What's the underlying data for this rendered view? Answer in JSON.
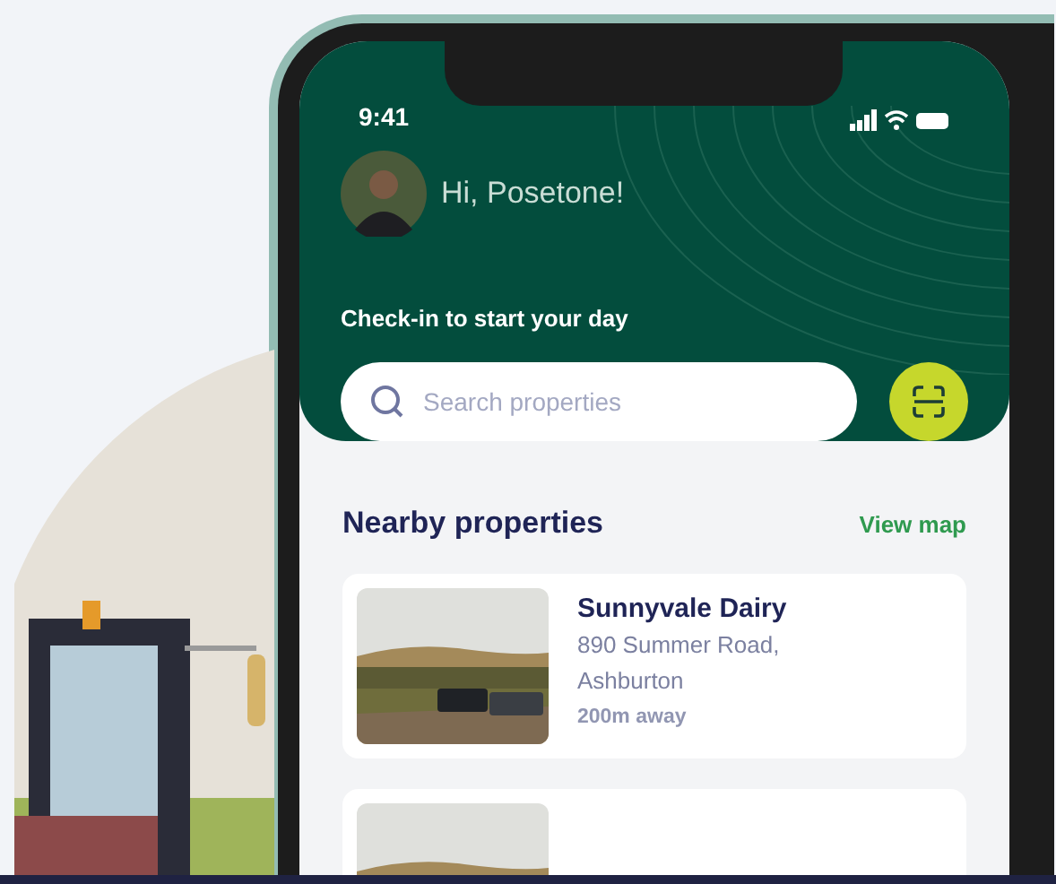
{
  "status_bar": {
    "time": "9:41"
  },
  "greeting": "Hi, Posetone!",
  "prompt": "Check-in to start your day",
  "search": {
    "placeholder": "Search properties"
  },
  "section": {
    "title": "Nearby properties",
    "link": "View map"
  },
  "properties": [
    {
      "image": {
        "kind": "picture"
      },
      "name": "Sunnyvale Dairy",
      "address": "890 Summer Road, Ashburton",
      "distance": "200m away"
    },
    {
      "image": {
        "kind": "picture"
      }
    }
  ]
}
